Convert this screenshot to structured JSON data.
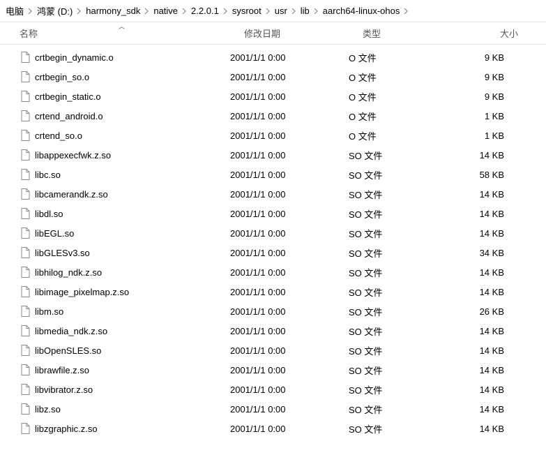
{
  "breadcrumb": [
    {
      "label": "电脑"
    },
    {
      "label": "鸿蒙 (D:)"
    },
    {
      "label": "harmony_sdk"
    },
    {
      "label": "native"
    },
    {
      "label": "2.2.0.1"
    },
    {
      "label": "sysroot"
    },
    {
      "label": "usr"
    },
    {
      "label": "lib"
    },
    {
      "label": "aarch64-linux-ohos"
    }
  ],
  "headers": {
    "name": "名称",
    "date": "修改日期",
    "type": "类型",
    "size": "大小"
  },
  "files": [
    {
      "name": "crtbegin_dynamic.o",
      "date": "2001/1/1 0:00",
      "type": "O 文件",
      "size": "9 KB"
    },
    {
      "name": "crtbegin_so.o",
      "date": "2001/1/1 0:00",
      "type": "O 文件",
      "size": "9 KB"
    },
    {
      "name": "crtbegin_static.o",
      "date": "2001/1/1 0:00",
      "type": "O 文件",
      "size": "9 KB"
    },
    {
      "name": "crtend_android.o",
      "date": "2001/1/1 0:00",
      "type": "O 文件",
      "size": "1 KB"
    },
    {
      "name": "crtend_so.o",
      "date": "2001/1/1 0:00",
      "type": "O 文件",
      "size": "1 KB"
    },
    {
      "name": "libappexecfwk.z.so",
      "date": "2001/1/1 0:00",
      "type": "SO 文件",
      "size": "14 KB"
    },
    {
      "name": "libc.so",
      "date": "2001/1/1 0:00",
      "type": "SO 文件",
      "size": "58 KB"
    },
    {
      "name": "libcamerandk.z.so",
      "date": "2001/1/1 0:00",
      "type": "SO 文件",
      "size": "14 KB"
    },
    {
      "name": "libdl.so",
      "date": "2001/1/1 0:00",
      "type": "SO 文件",
      "size": "14 KB"
    },
    {
      "name": "libEGL.so",
      "date": "2001/1/1 0:00",
      "type": "SO 文件",
      "size": "14 KB"
    },
    {
      "name": "libGLESv3.so",
      "date": "2001/1/1 0:00",
      "type": "SO 文件",
      "size": "34 KB"
    },
    {
      "name": "libhilog_ndk.z.so",
      "date": "2001/1/1 0:00",
      "type": "SO 文件",
      "size": "14 KB"
    },
    {
      "name": "libimage_pixelmap.z.so",
      "date": "2001/1/1 0:00",
      "type": "SO 文件",
      "size": "14 KB"
    },
    {
      "name": "libm.so",
      "date": "2001/1/1 0:00",
      "type": "SO 文件",
      "size": "26 KB"
    },
    {
      "name": "libmedia_ndk.z.so",
      "date": "2001/1/1 0:00",
      "type": "SO 文件",
      "size": "14 KB"
    },
    {
      "name": "libOpenSLES.so",
      "date": "2001/1/1 0:00",
      "type": "SO 文件",
      "size": "14 KB"
    },
    {
      "name": "librawfile.z.so",
      "date": "2001/1/1 0:00",
      "type": "SO 文件",
      "size": "14 KB"
    },
    {
      "name": "libvibrator.z.so",
      "date": "2001/1/1 0:00",
      "type": "SO 文件",
      "size": "14 KB"
    },
    {
      "name": "libz.so",
      "date": "2001/1/1 0:00",
      "type": "SO 文件",
      "size": "14 KB"
    },
    {
      "name": "libzgraphic.z.so",
      "date": "2001/1/1 0:00",
      "type": "SO 文件",
      "size": "14 KB"
    }
  ]
}
